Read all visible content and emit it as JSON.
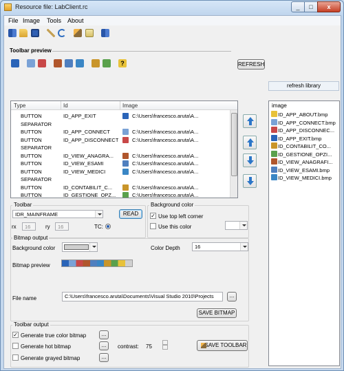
{
  "window": {
    "title": "Resource file: LabClient.rc",
    "close_glyph": "x",
    "min_glyph": "_",
    "max_glyph": "□"
  },
  "menu": [
    "File",
    "Image",
    "Tools",
    "About"
  ],
  "toolbar_icons": [
    "book-icon",
    "open-folder-icon",
    "save-icon",
    "pencil-icon",
    "refresh-icon",
    "hammer-icon",
    "edit-icon",
    "book-icon"
  ],
  "preview": {
    "heading": "Toolbar preview",
    "icons": [
      "exit-icon",
      "connect-icon",
      "disconnect-icon",
      "users-icon",
      "exams-icon",
      "doctors-icon",
      "accounting-icon",
      "options-icon",
      "about-icon"
    ],
    "refresh_label": "REFRESH"
  },
  "refresh_library_label": "refresh library",
  "list": {
    "columns": [
      "Type",
      "Id",
      "Image"
    ],
    "rows": [
      {
        "type": "BUTTON",
        "id": "ID_APP_EXIT",
        "image": "C:\\Users\\francesco.aruta\\A...",
        "icon": "#2a64b8"
      },
      {
        "type": "SEPARATOR",
        "id": "",
        "image": "",
        "icon": ""
      },
      {
        "type": "BUTTON",
        "id": "ID_APP_CONNECT",
        "image": "C:\\Users\\francesco.aruta\\A...",
        "icon": "#7aa2d6"
      },
      {
        "type": "BUTTON",
        "id": "ID_APP_DISCONNECT",
        "image": "C:\\Users\\francesco.aruta\\A...",
        "icon": "#c84848"
      },
      {
        "type": "SEPARATOR",
        "id": "",
        "image": "",
        "icon": ""
      },
      {
        "type": "BUTTON",
        "id": "ID_VIEW_ANAGRA...",
        "image": "C:\\Users\\francesco.aruta\\A...",
        "icon": "#b0562c"
      },
      {
        "type": "BUTTON",
        "id": "ID_VIEW_ESAMI",
        "image": "C:\\Users\\francesco.aruta\\A...",
        "icon": "#4f7fbf"
      },
      {
        "type": "BUTTON",
        "id": "ID_VIEW_MEDICI",
        "image": "C:\\Users\\francesco.aruta\\A...",
        "icon": "#3a86c5"
      },
      {
        "type": "SEPARATOR",
        "id": "",
        "image": "",
        "icon": ""
      },
      {
        "type": "BUTTON",
        "id": "ID_CONTABILIT_C...",
        "image": "C:\\Users\\francesco.aruta\\A...",
        "icon": "#c9952a"
      },
      {
        "type": "BUTTON",
        "id": "ID_GESTIONE_OPZ...",
        "image": "C:\\Users\\francesco.aruta\\A...",
        "icon": "#5aa14c"
      }
    ]
  },
  "library": {
    "header": "image",
    "items": [
      {
        "name": "ID_APP_ABOUT.bmp",
        "color": "#e8c23a"
      },
      {
        "name": "ID_APP_CONNECT.bmp",
        "color": "#7aa2d6"
      },
      {
        "name": "ID_APP_DISCONNEC...",
        "color": "#c84848"
      },
      {
        "name": "ID_APP_EXIT.bmp",
        "color": "#2a64b8"
      },
      {
        "name": "ID_CONTABILIT_CO...",
        "color": "#c9952a"
      },
      {
        "name": "ID_GESTIONE_OPZI...",
        "color": "#5aa14c"
      },
      {
        "name": "ID_VIEW_ANAGRAFI...",
        "color": "#b0562c"
      },
      {
        "name": "ID_VIEW_ESAMI.bmp",
        "color": "#4f7fbf"
      },
      {
        "name": "ID_VIEW_MEDICI.bmp",
        "color": "#3a86c5"
      }
    ]
  },
  "toolbar_group": {
    "title": "Toolbar",
    "id_value": "IDR_MAINFRAME",
    "read_label": "READ",
    "rx_label": "rx",
    "rx_value": "16",
    "ry_label": "ry",
    "ry_value": "16",
    "tc_label": "TC:"
  },
  "background_group": {
    "title": "Background color",
    "use_top_left_label": "Use top left corner",
    "use_top_left_checked": true,
    "use_this_label": "Use this color",
    "use_this_checked": false
  },
  "bitmap_output": {
    "title": "Bitmap output",
    "bg_label": "Background color",
    "depth_label": "Color Depth",
    "depth_value": "16",
    "preview_label": "Bitmap preview",
    "filename_label": "File name",
    "filename_value": "C:\\Users\\francesco.aruta\\Documents\\Visual Studio 2010\\Projects",
    "browse_label": "...",
    "save_label": "SAVE BITMAP"
  },
  "toolbar_output": {
    "title": "Toolbar output",
    "true_color_label": "Generate true color bitmap",
    "true_color_checked": true,
    "hot_label": "Generate hot bitmap",
    "hot_checked": false,
    "grayed_label": "Generate grayed bitmap",
    "grayed_checked": false,
    "browse_label": "...",
    "contrast_label": "contrast:",
    "contrast_value": "75",
    "save_label": "SAVE TOOLBAR"
  },
  "colors": {
    "accent": "#2c76c8",
    "selection": "#3399ff"
  }
}
